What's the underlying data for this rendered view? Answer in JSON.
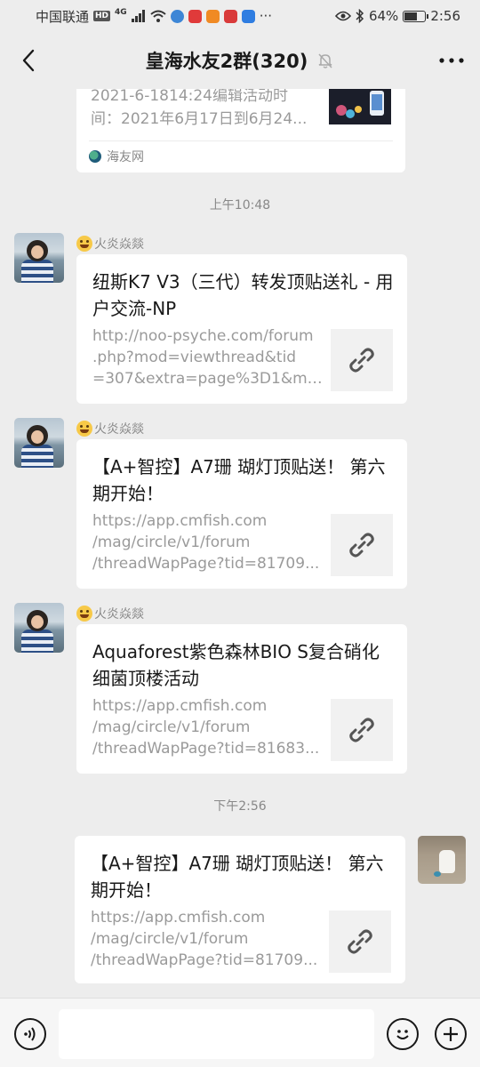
{
  "status_bar": {
    "carrier": "中国联通",
    "hd_badge": "HD",
    "network": "4G",
    "more": "···",
    "battery_percent": "64%",
    "battery_level": 0.64,
    "time": "2:56"
  },
  "header": {
    "title": "皇海水友2群(320)"
  },
  "partial_message": {
    "desc_line1": "2021-6-1814:24编辑活动时",
    "desc_line2": "间：2021年6月17日到6月24...",
    "source": "海友网"
  },
  "timestamps": {
    "first": "上午10:48",
    "second": "下午2:56"
  },
  "messages": [
    {
      "sender": "火炎焱燚",
      "title": "纽斯K7 V3（三代）转发顶贴送礼 - 用户交流-NP",
      "desc": [
        "http://noo-psyche.com/forum",
        ".php?mod=viewthread&tid",
        "=307&extra=page%3D1&mo..."
      ]
    },
    {
      "sender": "火炎焱燚",
      "title": "【A+智控】A7珊 瑚灯顶贴送！ 第六期开始！",
      "desc": [
        "https://app.cmfish.com",
        "/mag/circle/v1/forum",
        "/threadWapPage?tid=81709..."
      ]
    },
    {
      "sender": "火炎焱燚",
      "title": "Aquaforest紫色森林BIO S复合硝化细菌顶楼活动",
      "desc": [
        "https://app.cmfish.com",
        "/mag/circle/v1/forum",
        "/threadWapPage?tid=81683..."
      ]
    },
    {
      "sender": "",
      "title": "【A+智控】A7珊 瑚灯顶贴送！ 第六期开始！",
      "desc": [
        "https://app.cmfish.com",
        "/mag/circle/v1/forum",
        "/threadWapPage?tid=81709..."
      ]
    }
  ],
  "input_bar": {
    "placeholder": ""
  },
  "icons": {
    "back": "chevron-left-icon",
    "mute": "bell-off-icon",
    "more": "more-icon",
    "link": "link-icon",
    "voice": "voice-icon",
    "emoji": "emoji-icon",
    "add": "plus-icon"
  }
}
